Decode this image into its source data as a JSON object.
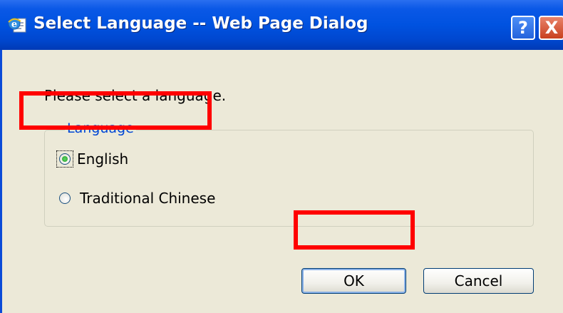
{
  "window": {
    "title": "Select Language -- Web Page Dialog",
    "help_glyph": "?",
    "close_glyph": "X"
  },
  "dialog": {
    "prompt": "Please select a language.",
    "group_label": "Language",
    "options": [
      {
        "label": "English",
        "selected": true
      },
      {
        "label": "Traditional Chinese",
        "selected": false
      }
    ],
    "ok_label": "OK",
    "cancel_label": "Cancel"
  },
  "colors": {
    "titlebar": "#0052e0",
    "highlight": "#ff0000",
    "group_label": "#0046d5",
    "dialog_bg": "#ece9d8"
  }
}
